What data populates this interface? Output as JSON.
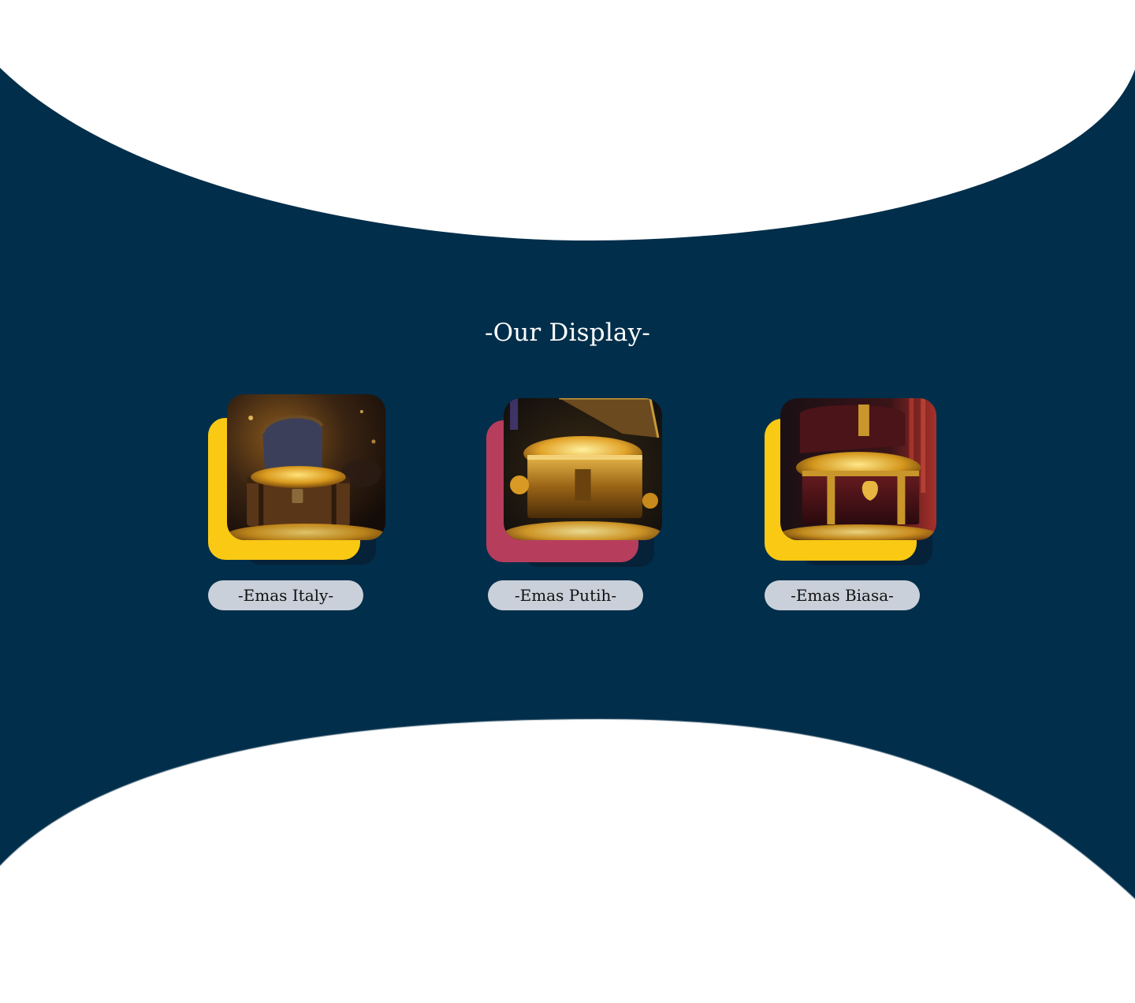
{
  "section": {
    "title": "-Our Display-"
  },
  "colors": {
    "background_navy": "#012e4a",
    "accent_yellow": "#f9c914",
    "accent_crimson": "#b73d5d",
    "pill_gray": "#c9d0da"
  },
  "cards": [
    {
      "label": "-Emas Italy-",
      "accent_color": "#f9c914",
      "image": "treasure-chest-open-wooden"
    },
    {
      "label": "-Emas Putih-",
      "accent_color": "#b73d5d",
      "image": "treasure-chest-ornate-gold"
    },
    {
      "label": "-Emas Biasa-",
      "accent_color": "#f9c914",
      "image": "treasure-chest-dark-red-velvet"
    }
  ]
}
